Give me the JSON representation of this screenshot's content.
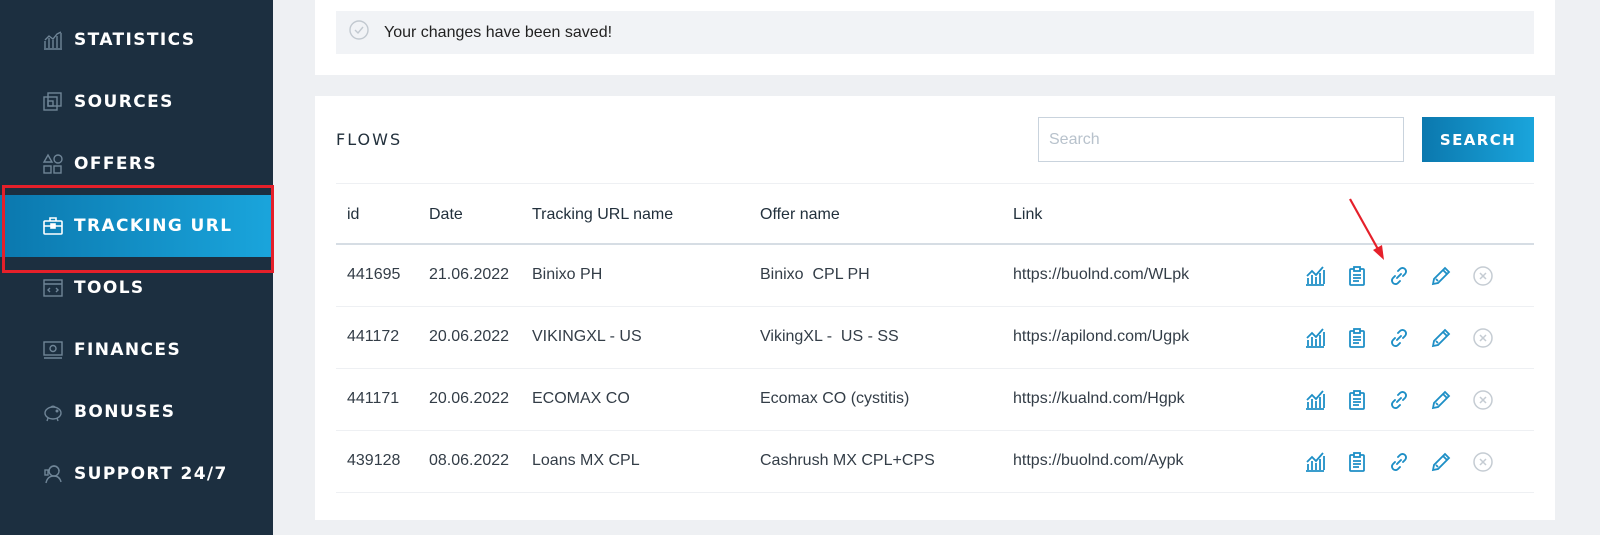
{
  "sidebar": {
    "items": [
      {
        "label": "STATISTICS",
        "icon": "statistics-icon"
      },
      {
        "label": "SOURCES",
        "icon": "sources-icon"
      },
      {
        "label": "OFFERS",
        "icon": "offers-icon"
      },
      {
        "label": "TRACKING URL",
        "icon": "briefcase-icon",
        "active": true
      },
      {
        "label": "TOOLS",
        "icon": "tools-icon"
      },
      {
        "label": "FINANCES",
        "icon": "finances-icon"
      },
      {
        "label": "BONUSES",
        "icon": "piggy-bank-icon"
      },
      {
        "label": "SUPPORT 24/7",
        "icon": "support-icon"
      }
    ]
  },
  "notice": {
    "text": "Your changes have been saved!",
    "icon": "check-circle-icon"
  },
  "flows": {
    "title": "FLOWS",
    "search_placeholder": "Search",
    "search_value": "",
    "search_button": "SEARCH",
    "columns": [
      "id",
      "Date",
      "Tracking URL name",
      "Offer name",
      "Link"
    ],
    "rows": [
      {
        "id": "441695",
        "date": "21.06.2022",
        "name": "Binixo PH",
        "offer": "Binixo  CPL PH",
        "link": "https://buolnd.com/WLpk"
      },
      {
        "id": "441172",
        "date": "20.06.2022",
        "name": "VIKINGXL - US",
        "offer": "VikingXL -  US - SS",
        "link": "https://apilond.com/Ugpk"
      },
      {
        "id": "441171",
        "date": "20.06.2022",
        "name": "ECOMAX CO",
        "offer": "Ecomax CO (cystitis)",
        "link": "https://kualnd.com/Hgpk"
      },
      {
        "id": "439128",
        "date": "08.06.2022",
        "name": "Loans MX CPL",
        "offer": "Cashrush MX CPL+CPS",
        "link": "https://buolnd.com/Aypk"
      }
    ],
    "row_action_icons": [
      "stats-chart-icon",
      "clipboard-icon",
      "link-icon",
      "pencil-icon",
      "close-circle-icon"
    ]
  },
  "colors": {
    "sidebar_bg": "#1c2f40",
    "accent": "#1aa5dc",
    "highlight": "#e5202a",
    "icon_blue": "#1e8fc6"
  }
}
